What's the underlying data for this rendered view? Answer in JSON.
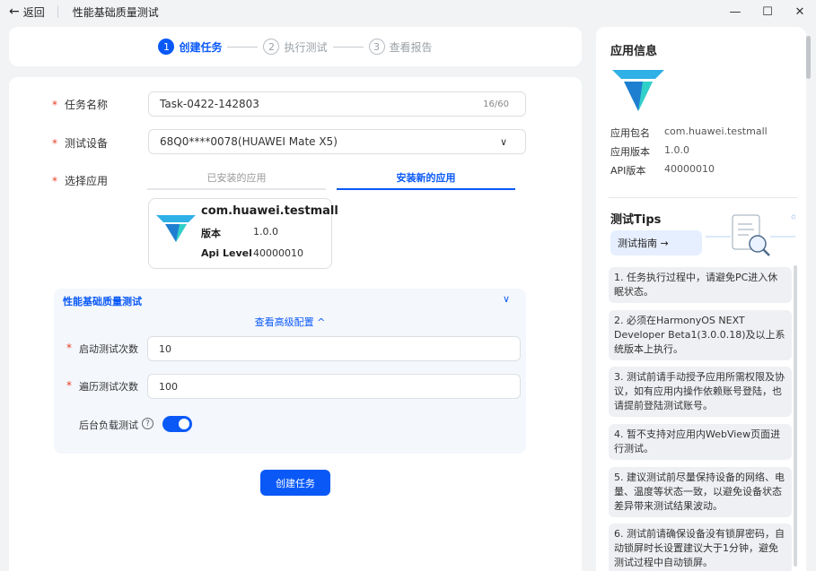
{
  "window": {
    "back_label": "返回",
    "title": "性能基础质量测试",
    "controls": {
      "minimize": "—",
      "maximize": "☐",
      "close": "✕"
    }
  },
  "stepper": {
    "steps": [
      {
        "num": "1",
        "label": "创建任务",
        "active": true
      },
      {
        "num": "2",
        "label": "执行测试",
        "active": false
      },
      {
        "num": "3",
        "label": "查看报告",
        "active": false
      }
    ]
  },
  "form": {
    "task_name": {
      "label": "任务名称",
      "value": "Task-0422-142803",
      "count": "16/60"
    },
    "device": {
      "label": "测试设备",
      "value": "68Q0****0078(HUAWEI Mate X5)"
    },
    "app": {
      "label": "选择应用",
      "tabs": [
        "已安装的应用",
        "安装新的应用"
      ],
      "card": {
        "package": "com.huawei.testmall",
        "version_label": "版本",
        "version": "1.0.0",
        "api_label": "Api Level",
        "api": "40000010"
      }
    },
    "advanced": {
      "title": "性能基础质量测试",
      "link": "查看高级配置 ^",
      "launch_count_label": "启动测试次数",
      "launch_count": "10",
      "traverse_count_label": "遍历测试次数",
      "traverse_count": "100",
      "background_label": "后台负载测试",
      "background_on": true
    },
    "create_button": "创建任务"
  },
  "app_info": {
    "title": "应用信息",
    "rows": [
      {
        "k": "应用包名",
        "v": "com.huawei.testmall"
      },
      {
        "k": "应用版本",
        "v": "1.0.0"
      },
      {
        "k": "API版本",
        "v": "40000010"
      }
    ]
  },
  "tips": {
    "title": "测试Tips",
    "guide_button": "测试指南 →",
    "items": [
      "1. 任务执行过程中，请避免PC进入休眠状态。",
      "2. 必须在HarmonyOS NEXT Developer Beta1(3.0.0.18)及以上系统版本上执行。",
      "3. 测试前请手动授予应用所需权限及协议，如有应用内操作依赖账号登陆，也请提前登陆测试账号。",
      "4. 暂不支持对应用内WebView页面进行测试。",
      "5. 建议测试前尽量保持设备的网络、电量、温度等状态一致，以避免设备状态差异带来测试结果波动。",
      "6. 测试前请确保设备没有锁屏密码，自动锁屏时长设置建议大于1分钟，避免测试过程中自动锁屏。"
    ]
  },
  "colors": {
    "accent": "#0a59f7",
    "required": "#e84026"
  }
}
